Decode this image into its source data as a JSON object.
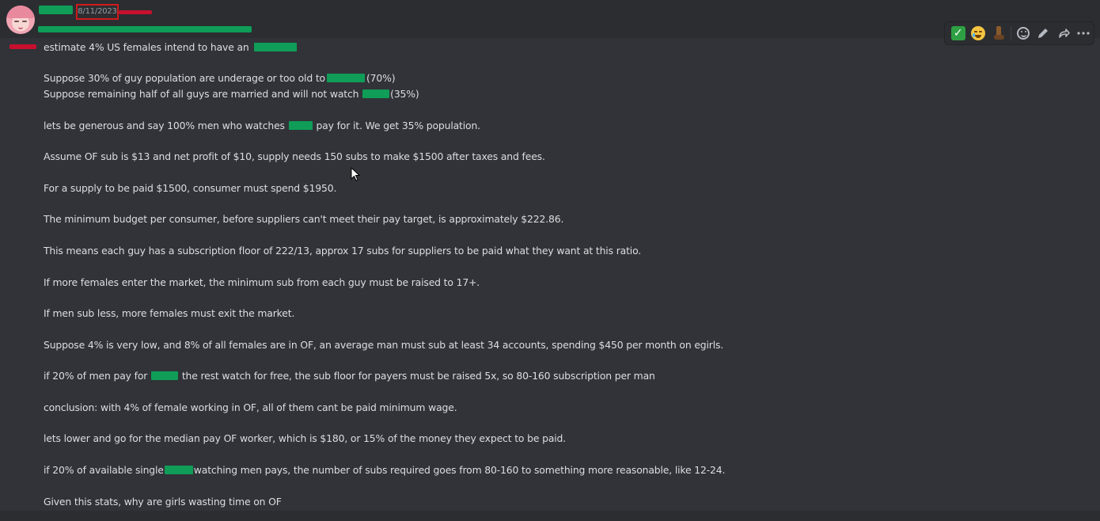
{
  "header": {
    "timestamp": "8/11/2023"
  },
  "toolbar": {
    "reactions": [
      "check-mark-emoji",
      "joy-emoji",
      "boot-emoji"
    ],
    "actions": [
      "add-reaction-icon",
      "edit-icon",
      "forward-icon",
      "more-icon"
    ],
    "check_glyph": "✓"
  },
  "message": {
    "lines": [
      "estimate 4% US females intend to have an",
      "Suppose 30% of guy population are underage or too old to",
      "(70%)",
      "Suppose remaining half of all guys are married and will not watch",
      "(35%)",
      "lets be generous and say 100% men who watches",
      "pay for it. We get 35% population.",
      "Assume OF sub is $13 and net profit of $10, supply needs 150 subs to make $1500 after taxes and fees.",
      "For a supply to be paid $1500, consumer must spend $1950.",
      "The minimum budget per consumer, before suppliers can't meet their pay target, is approximately $222.86.",
      "This means each guy has a subscription floor of 222/13, approx 17 subs for suppliers to be paid what they want at this ratio.",
      "If more females enter the market, the minimum sub from each guy must be raised to 17+.",
      "If men sub less, more females must exit the market.",
      "Suppose 4% is very low, and 8% of all females are in OF, an average man must sub at least 34 accounts, spending $450 per month on egirls.",
      "if 20% of men pay for",
      "the rest watch for free, the sub floor for payers must be raised 5x, so 80-160 subscription per man",
      "conclusion: with 4% of female working in OF, all of them cant be paid minimum wage.",
      "lets lower and go for the median pay OF worker, which is $180, or 15% of the money they expect to be paid.",
      "if 20% of available single",
      "watching men pays, the number of subs required goes from 80-160 to something more reasonable, like 12-24.",
      "Given this stats, why are girls wasting time on OF"
    ]
  },
  "colors": {
    "background": "#313338",
    "header_band": "#2b2d31",
    "text": "#dbdee1",
    "redaction_green": "#0f9d58",
    "redaction_red": "#c8102e",
    "timestamp_border": "#d11b1b"
  }
}
